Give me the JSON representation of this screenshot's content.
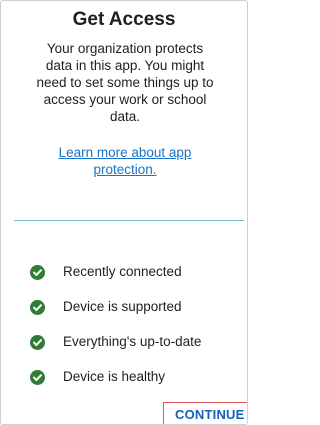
{
  "title": "Get Access",
  "description_lines": [
    "Your organization protects",
    "data in this app. You might",
    "need to set some things up to",
    "access your work or school",
    "data."
  ],
  "learn_more_lines": [
    "Learn more about app",
    "protection."
  ],
  "checks": [
    {
      "label": "Recently connected",
      "icon": "check-circle-icon",
      "status": "passed"
    },
    {
      "label": "Device is supported",
      "icon": "check-circle-icon",
      "status": "passed"
    },
    {
      "label": "Everything's up-to-date",
      "icon": "check-circle-icon",
      "status": "passed"
    },
    {
      "label": "Device is healthy",
      "icon": "check-circle-icon",
      "status": "passed"
    }
  ],
  "continue_label": "CONTINUE",
  "colors": {
    "check_green": "#2e7d32",
    "link_blue": "#1a73c7",
    "button_text": "#1a5fb4",
    "divider": "#7ab8cf",
    "highlight_border": "#e05a5a"
  }
}
